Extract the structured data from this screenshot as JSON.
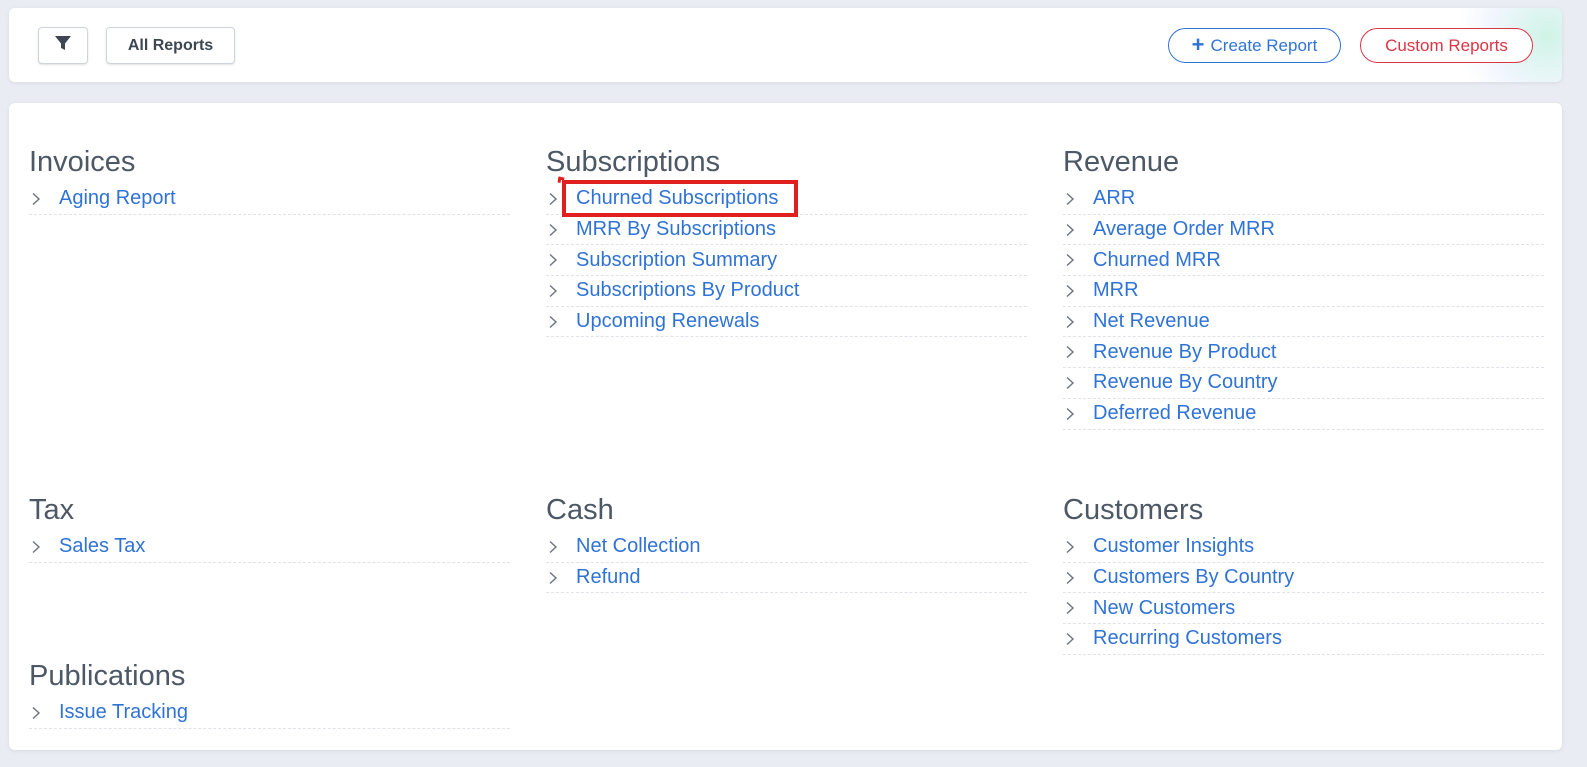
{
  "toolbar": {
    "filter_icon": "filter-icon",
    "all_reports_label": "All Reports",
    "create_report_label": "Create Report",
    "create_icon": "plus-icon",
    "custom_reports_label": "Custom Reports"
  },
  "colors": {
    "link": "#2f73d6",
    "heading": "#4d5866",
    "danger": "#dc3545",
    "highlight": "#e0201f"
  },
  "sections": [
    {
      "title": "Invoices",
      "items": [
        "Aging Report"
      ]
    },
    {
      "title": "Subscriptions",
      "items": [
        "Churned Subscriptions",
        "MRR By Subscriptions",
        "Subscription Summary",
        "Subscriptions By Product",
        "Upcoming Renewals"
      ]
    },
    {
      "title": "Revenue",
      "items": [
        "ARR",
        "Average Order MRR",
        "Churned MRR",
        "MRR",
        "Net Revenue",
        "Revenue By Product",
        "Revenue By Country",
        "Deferred Revenue"
      ]
    },
    {
      "title": "Tax",
      "items": [
        "Sales Tax"
      ]
    },
    {
      "title": "Cash",
      "items": [
        "Net Collection",
        "Refund"
      ]
    },
    {
      "title": "Customers",
      "items": [
        "Customer Insights",
        "Customers By Country",
        "New Customers",
        "Recurring Customers"
      ]
    },
    {
      "title": "Publications",
      "items": [
        "Issue Tracking"
      ]
    }
  ]
}
